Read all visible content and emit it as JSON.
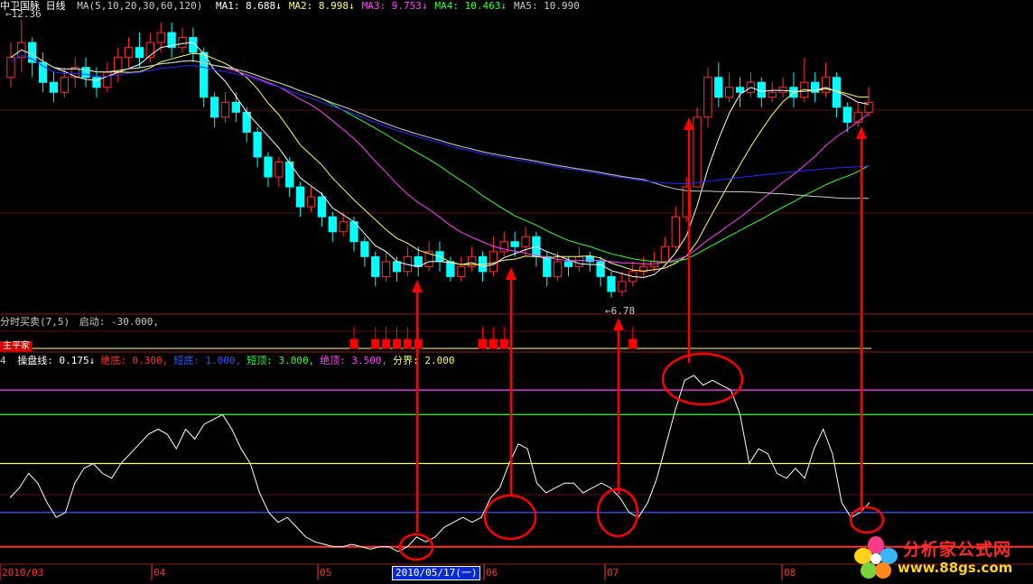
{
  "header": {
    "title": "中卫国脉 日线",
    "ma_label": "MA(5,10,20,30,60,120)",
    "items": [
      {
        "name": "MA1:",
        "value": "8.688↓",
        "color": "#ffffff"
      },
      {
        "name": "MA2:",
        "value": "8.998↓",
        "color": "#ffff66"
      },
      {
        "name": "MA3:",
        "value": "9.753↓",
        "color": "#ff44ff"
      },
      {
        "name": "MA4:",
        "value": "10.463↓",
        "color": "#33ff33"
      },
      {
        "name": "MA5:",
        "value": "10.990",
        "color": "#cccccc"
      }
    ],
    "high_label": "12.36",
    "low_label": "6.78"
  },
  "indicator1": {
    "title": "分时买卖(7,5)",
    "param": "启动: -30.000,",
    "tag": "主平家"
  },
  "indicator2": {
    "prefix": "4",
    "items": [
      {
        "name": "操盘线:",
        "value": "0.175↓",
        "color": "#ffffff"
      },
      {
        "name": "绝底:",
        "value": "0.300,",
        "color": "#ff3333"
      },
      {
        "name": "短底:",
        "value": "1.000,",
        "color": "#3355ff"
      },
      {
        "name": "短顶:",
        "value": "3.000,",
        "color": "#33ff33"
      },
      {
        "name": "绝顶:",
        "value": "3.500,",
        "color": "#ff44ff"
      },
      {
        "name": "分界:",
        "value": "2.000",
        "color": "#ffff66"
      }
    ]
  },
  "axis": {
    "months": [
      "2010/03",
      "04",
      "05",
      "06",
      "07",
      "08"
    ],
    "cursor_date": "2010/05/17(一)"
  },
  "logo": {
    "line1": "分析家公式网",
    "line2": "www.88gs.com"
  },
  "colors": {
    "up": "#ff3030",
    "down": "#00ffff",
    "ma5": "#ffffff",
    "ma10": "#ffff66",
    "ma20": "#ff44ff",
    "ma30": "#33ff33",
    "ma60": "#cccccc",
    "ma120": "#2a2aff",
    "annotation": "#ff0000"
  },
  "chart_data": [
    {
      "type": "candlestick",
      "title": "中卫国脉 日线",
      "ylim": [
        6.5,
        12.5
      ],
      "x_start": "2010/03",
      "x_end": "2010/08",
      "candles": [
        [
          11.2,
          11.6,
          11.9,
          11.0
        ],
        [
          11.6,
          11.9,
          12.36,
          11.3
        ],
        [
          11.9,
          11.5,
          12.0,
          11.2
        ],
        [
          11.5,
          11.1,
          11.7,
          10.9
        ],
        [
          11.1,
          10.9,
          11.3,
          10.7
        ],
        [
          10.9,
          11.2,
          11.4,
          10.8
        ],
        [
          11.2,
          11.4,
          11.6,
          11.0
        ],
        [
          11.4,
          11.2,
          11.6,
          11.0
        ],
        [
          11.2,
          11.0,
          11.4,
          10.8
        ],
        [
          11.0,
          11.3,
          11.5,
          10.9
        ],
        [
          11.3,
          11.6,
          11.8,
          11.1
        ],
        [
          11.6,
          11.8,
          12.0,
          11.4
        ],
        [
          11.8,
          11.6,
          12.1,
          11.4
        ],
        [
          11.6,
          11.9,
          12.1,
          11.5
        ],
        [
          11.9,
          12.1,
          12.3,
          11.7
        ],
        [
          12.1,
          11.8,
          12.3,
          11.6
        ],
        [
          11.8,
          12.0,
          12.2,
          11.7
        ],
        [
          12.0,
          11.7,
          12.2,
          11.5
        ],
        [
          11.7,
          10.8,
          11.8,
          10.6
        ],
        [
          10.8,
          10.4,
          10.9,
          10.2
        ],
        [
          10.4,
          10.7,
          10.9,
          10.3
        ],
        [
          10.7,
          10.5,
          10.9,
          10.3
        ],
        [
          10.5,
          10.1,
          10.6,
          9.9
        ],
        [
          10.1,
          9.6,
          10.2,
          9.4
        ],
        [
          9.6,
          9.2,
          9.7,
          9.0
        ],
        [
          9.2,
          9.5,
          9.6,
          9.0
        ],
        [
          9.5,
          9.0,
          9.6,
          8.8
        ],
        [
          9.0,
          8.6,
          9.1,
          8.4
        ],
        [
          8.6,
          8.8,
          9.0,
          8.5
        ],
        [
          8.8,
          8.4,
          8.9,
          8.2
        ],
        [
          8.4,
          8.1,
          8.5,
          7.9
        ],
        [
          8.1,
          8.3,
          8.5,
          8.0
        ],
        [
          8.3,
          7.9,
          8.4,
          7.7
        ],
        [
          7.9,
          7.6,
          8.0,
          7.4
        ],
        [
          7.6,
          7.2,
          7.7,
          7.0
        ],
        [
          7.2,
          7.5,
          7.7,
          7.1
        ],
        [
          7.5,
          7.3,
          7.6,
          7.1
        ],
        [
          7.3,
          7.6,
          7.8,
          7.2
        ],
        [
          7.6,
          7.4,
          7.8,
          7.2
        ],
        [
          7.4,
          7.7,
          7.9,
          7.3
        ],
        [
          7.7,
          7.5,
          7.9,
          7.3
        ],
        [
          7.5,
          7.2,
          7.6,
          7.1
        ],
        [
          7.2,
          7.4,
          7.6,
          7.1
        ],
        [
          7.4,
          7.6,
          7.8,
          7.3
        ],
        [
          7.6,
          7.3,
          7.7,
          7.1
        ],
        [
          7.3,
          7.7,
          8.0,
          7.2
        ],
        [
          7.7,
          7.9,
          8.1,
          7.6
        ],
        [
          7.9,
          7.8,
          8.1,
          7.6
        ],
        [
          7.8,
          8.0,
          8.2,
          7.6
        ],
        [
          8.0,
          7.6,
          8.1,
          7.4
        ],
        [
          7.6,
          7.2,
          7.7,
          7.0
        ],
        [
          7.2,
          7.5,
          7.7,
          7.1
        ],
        [
          7.5,
          7.4,
          7.6,
          7.2
        ],
        [
          7.4,
          7.6,
          7.8,
          7.3
        ],
        [
          7.6,
          7.5,
          7.7,
          7.3
        ],
        [
          7.5,
          7.2,
          7.6,
          7.0
        ],
        [
          7.2,
          6.9,
          7.3,
          6.78
        ],
        [
          6.9,
          7.1,
          7.3,
          6.8
        ],
        [
          7.1,
          7.3,
          7.5,
          7.0
        ],
        [
          7.3,
          7.4,
          7.6,
          7.2
        ],
        [
          7.4,
          7.5,
          7.7,
          7.3
        ],
        [
          7.5,
          7.8,
          8.0,
          7.4
        ],
        [
          7.8,
          8.4,
          8.6,
          7.7
        ],
        [
          8.4,
          9.0,
          9.2,
          8.3
        ],
        [
          9.0,
          10.4,
          10.6,
          9.0
        ],
        [
          10.4,
          11.2,
          11.4,
          10.2
        ],
        [
          11.2,
          10.8,
          11.5,
          10.6
        ],
        [
          10.8,
          11.0,
          11.3,
          10.7
        ],
        [
          11.0,
          10.9,
          11.2,
          10.6
        ],
        [
          10.9,
          11.1,
          11.3,
          10.8
        ],
        [
          11.1,
          10.8,
          11.2,
          10.6
        ],
        [
          10.8,
          10.9,
          11.1,
          10.7
        ],
        [
          10.9,
          11.0,
          11.2,
          10.8
        ],
        [
          11.0,
          10.8,
          11.3,
          10.6
        ],
        [
          10.8,
          11.1,
          11.6,
          10.7
        ],
        [
          11.1,
          10.9,
          11.3,
          10.7
        ],
        [
          10.9,
          11.2,
          11.5,
          10.8
        ],
        [
          11.2,
          10.6,
          11.3,
          10.4
        ],
        [
          10.6,
          10.3,
          10.7,
          10.1
        ],
        [
          10.3,
          10.5,
          10.7,
          10.2
        ],
        [
          10.5,
          10.7,
          11.0,
          10.4
        ]
      ]
    },
    {
      "type": "line",
      "title": "操盘线",
      "ylim": [
        0,
        4
      ],
      "levels": [
        {
          "name": "绝底",
          "value": 0.3,
          "color": "#ff3333"
        },
        {
          "name": "短底",
          "value": 1.0,
          "color": "#3355ff"
        },
        {
          "name": "分界",
          "value": 2.0,
          "color": "#ffff66"
        },
        {
          "name": "短顶",
          "value": 3.0,
          "color": "#33ff33"
        },
        {
          "name": "绝顶",
          "value": 3.5,
          "color": "#ff44ff"
        }
      ],
      "series": [
        {
          "name": "操盘线",
          "values": [
            1.3,
            1.5,
            1.8,
            1.6,
            1.2,
            0.9,
            1.0,
            1.6,
            1.9,
            2.0,
            1.8,
            1.7,
            2.0,
            2.2,
            2.4,
            2.6,
            2.7,
            2.6,
            2.3,
            2.7,
            2.5,
            2.8,
            2.9,
            3.0,
            2.7,
            2.3,
            2.0,
            1.4,
            1.0,
            0.8,
            0.9,
            0.7,
            0.5,
            0.4,
            0.35,
            0.3,
            0.3,
            0.35,
            0.3,
            0.25,
            0.3,
            0.3,
            0.2,
            0.3,
            0.5,
            0.4,
            0.5,
            0.7,
            0.8,
            0.9,
            0.8,
            0.9,
            1.3,
            1.5,
            2.0,
            2.4,
            2.3,
            1.6,
            1.4,
            1.5,
            1.6,
            1.6,
            1.4,
            1.5,
            1.6,
            1.5,
            1.3,
            1.0,
            0.9,
            1.2,
            1.7,
            2.4,
            3.1,
            3.7,
            3.8,
            3.6,
            3.7,
            3.6,
            3.5,
            3.0,
            2.0,
            2.3,
            2.2,
            1.8,
            1.7,
            1.9,
            1.7,
            2.3,
            2.7,
            2.2,
            1.2,
            0.9,
            1.0,
            1.2
          ]
        }
      ]
    }
  ]
}
